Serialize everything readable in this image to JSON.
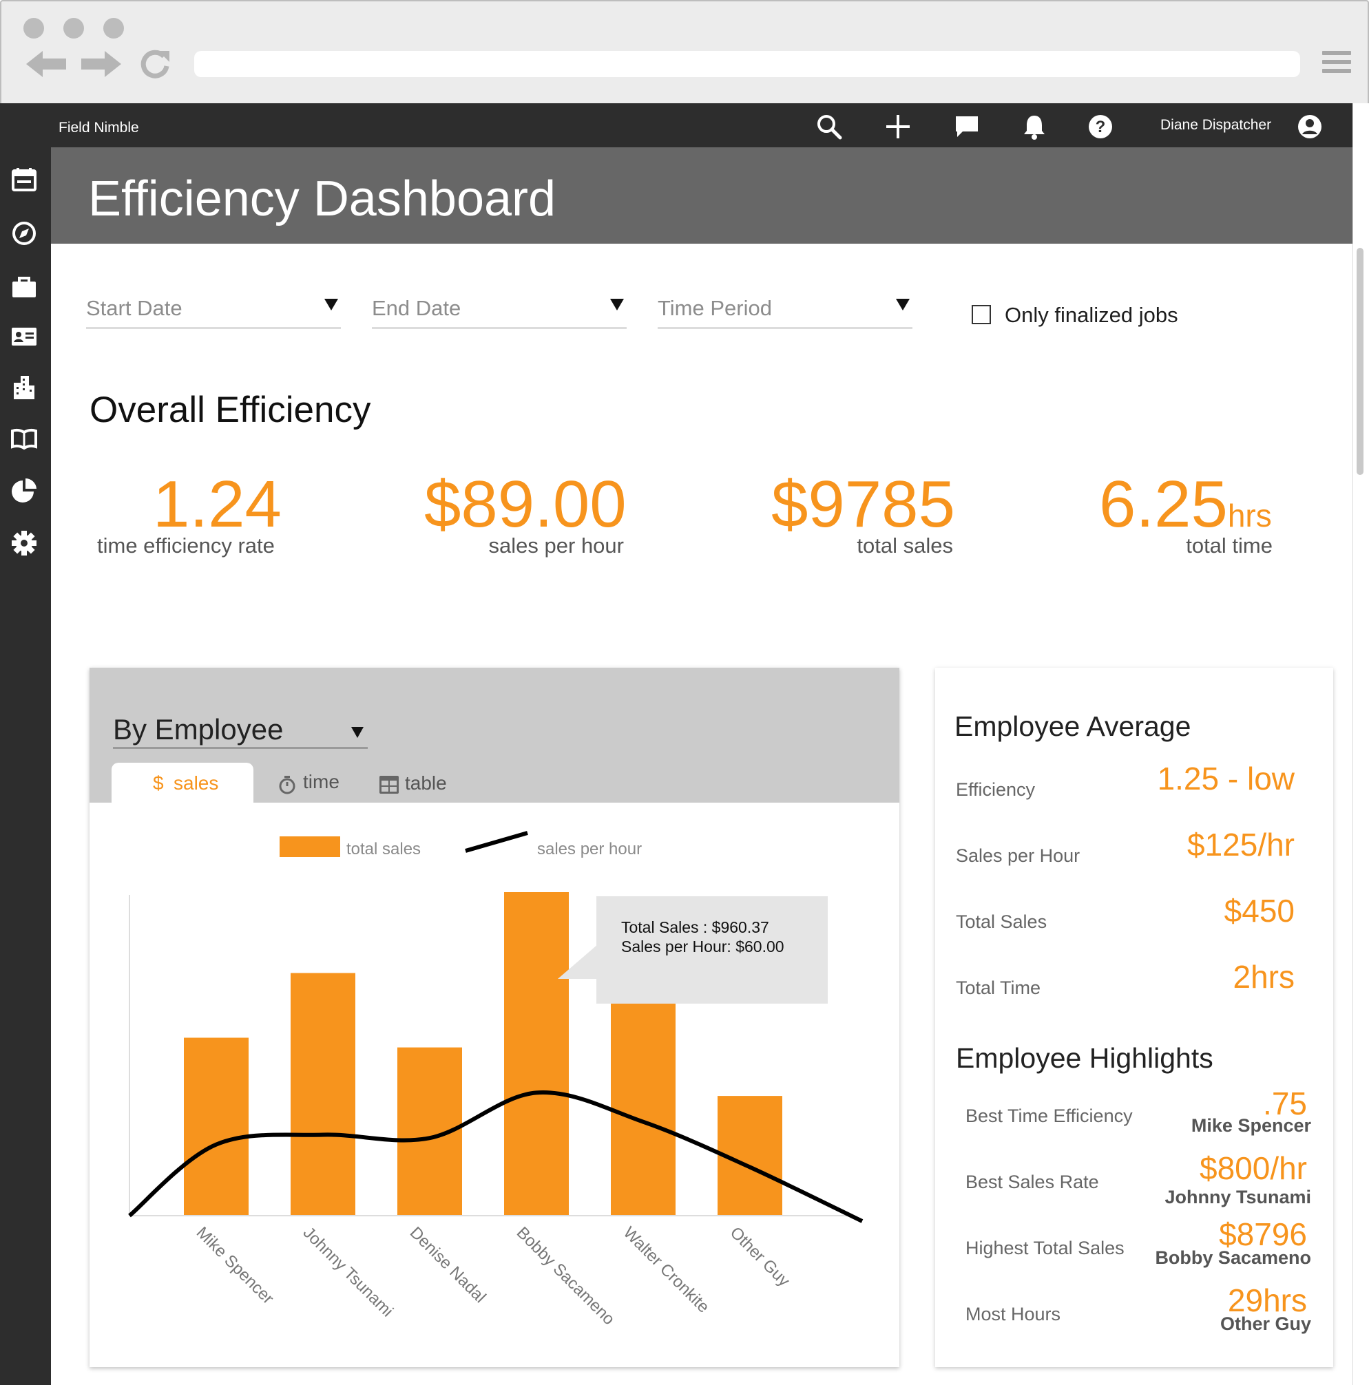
{
  "app": {
    "brand": "Field Nimble",
    "user_name": "Diane Dispatcher",
    "page_title": "Efficiency Dashboard",
    "icons": [
      "menu-expand-icon",
      "search-icon",
      "plus-icon",
      "chat-icon",
      "bell-icon",
      "help-icon",
      "user-icon"
    ]
  },
  "sidebar": {
    "items": [
      {
        "icon": "calendar-icon"
      },
      {
        "icon": "compass-icon"
      },
      {
        "icon": "briefcase-icon"
      },
      {
        "icon": "contact-card-icon"
      },
      {
        "icon": "building-icon"
      },
      {
        "icon": "book-icon"
      },
      {
        "icon": "pie-chart-icon"
      },
      {
        "icon": "gear-icon"
      }
    ]
  },
  "filters": {
    "start_date": "Start Date",
    "end_date": "End Date",
    "time_period": "Time Period",
    "finalized_label": "Only finalized jobs",
    "finalized_checked": false
  },
  "overall": {
    "title": "Overall Efficiency",
    "efficiency_value": "1.24",
    "efficiency_label": "time efficiency rate",
    "sales_per_hour_value": "$89.00",
    "sales_per_hour_label": "sales per hour",
    "total_sales_value": "$9785",
    "total_sales_label": "total sales",
    "total_time_value": "6.25",
    "total_time_unit": "hrs",
    "total_time_label": "total time"
  },
  "breakdown": {
    "select_value": "By Employee",
    "tabs": [
      {
        "icon": "dollar-icon",
        "icon_text": "$",
        "label": "sales",
        "active": true
      },
      {
        "icon": "stopwatch-icon",
        "label": "time",
        "active": false
      },
      {
        "icon": "table-icon",
        "label": "table",
        "active": false
      }
    ],
    "tooltip": {
      "line1": "Total Sales : $960.37",
      "line2": "Sales per Hour:  $60.00"
    }
  },
  "chart_data": {
    "type": "bar",
    "categories": [
      "Mike Spencer",
      "Johnny Tsunami",
      "Denise Nadal",
      "Bobby Sacameno",
      "Walter Cronkite",
      "Other Guy"
    ],
    "series": [
      {
        "name": "total sales",
        "type": "bar",
        "values": [
          55,
          75,
          52,
          100,
          74,
          37
        ]
      },
      {
        "name": "sales per hour",
        "type": "line",
        "values": [
          22,
          25,
          24,
          38,
          29,
          15
        ]
      }
    ],
    "ylim": [
      0,
      100
    ],
    "colors": {
      "bar": "#f7941d",
      "line": "#000000"
    },
    "legend": "top-center",
    "grid": false
  },
  "employee_average": {
    "title": "Employee Average",
    "rows": [
      {
        "label": "Efficiency",
        "value": "1.25 - low"
      },
      {
        "label": "Sales per Hour",
        "value": "$125/hr"
      },
      {
        "label": "Total Sales",
        "value": "$450"
      },
      {
        "label": "Total Time",
        "value": "2hrs"
      }
    ]
  },
  "employee_highlights": {
    "title": "Employee Highlights",
    "rows": [
      {
        "label": "Best Time Efficiency",
        "value": ".75",
        "name": "Mike Spencer"
      },
      {
        "label": "Best Sales Rate",
        "value": "$800/hr",
        "name": "Johnny Tsunami"
      },
      {
        "label": "Highest Total Sales",
        "value": "$8796",
        "name": "Bobby Sacameno"
      },
      {
        "label": "Most Hours",
        "value": "29hrs",
        "name": "Other Guy"
      }
    ]
  },
  "colors": {
    "accent": "#f7941d",
    "nav_dark": "#2d2d2d",
    "header_gray": "#676767"
  }
}
